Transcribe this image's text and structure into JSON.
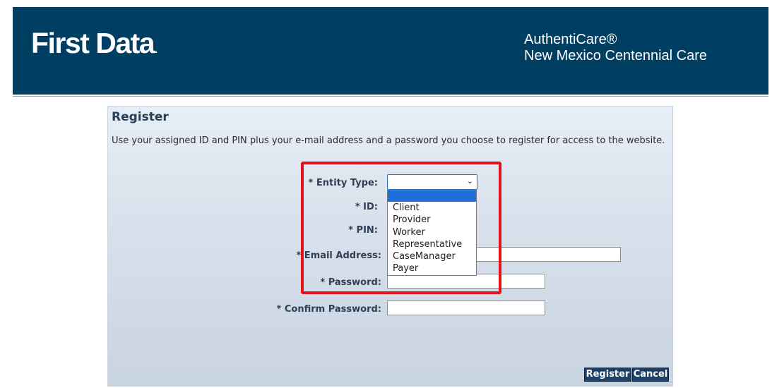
{
  "header": {
    "logo_text": "First Data",
    "logo_mark": ".",
    "product_name": "AuthentiCare®",
    "product_subtitle": "New Mexico Centennial Care",
    "bg_color": "#003f62"
  },
  "panel": {
    "title": "Register",
    "instructions": "Use your assigned ID and PIN plus your e-mail address and a password you choose to register for access to the website."
  },
  "form": {
    "entity_type_label": "* Entity Type:",
    "id_label": "* ID:",
    "pin_label": "* PIN:",
    "email_label": "* Email Address:",
    "password_label": "* Password:",
    "confirm_password_label": "* Confirm Password:",
    "entity_type_value": "",
    "chevron": "⌄"
  },
  "dropdown": {
    "selected_option": "",
    "options": [
      "Client",
      "Provider",
      "Worker",
      "Representative",
      "CaseManager",
      "Payer"
    ],
    "highlight_color": "#1e6fd9"
  },
  "buttons": {
    "register": "Register",
    "cancel": "Cancel"
  },
  "annotation": {
    "box_color": "#e2141a"
  }
}
